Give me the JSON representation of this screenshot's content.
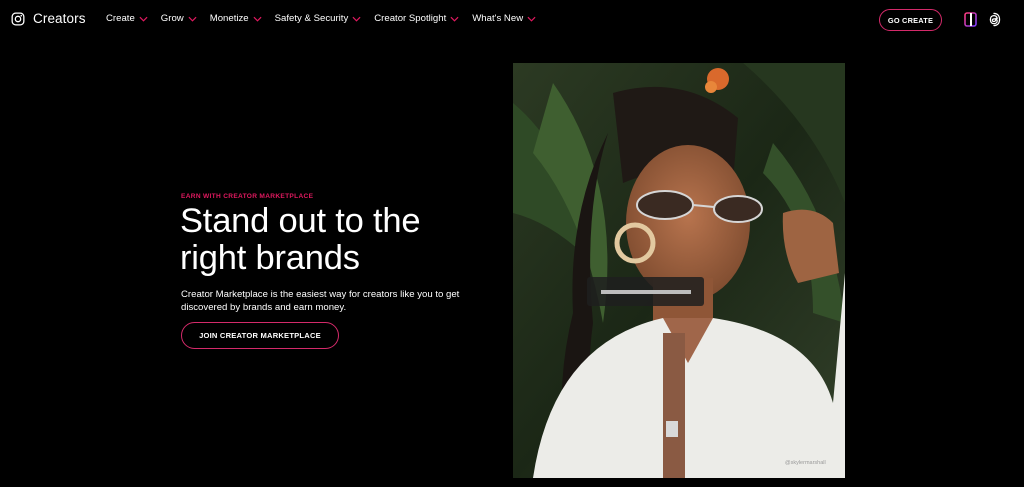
{
  "brand": {
    "name": "Creators",
    "icon": "instagram-icon"
  },
  "nav": {
    "items": [
      {
        "label": "Create"
      },
      {
        "label": "Grow"
      },
      {
        "label": "Monetize"
      },
      {
        "label": "Safety & Security"
      },
      {
        "label": "Creator Spotlight"
      },
      {
        "label": "What's New"
      }
    ],
    "go_create_label": "GO CREATE"
  },
  "hero": {
    "eyebrow": "EARN WITH CREATOR MARKETPLACE",
    "headline": "Stand out to the right brands",
    "body": "Creator Marketplace is the easiest way for creators like you to get discovered by brands and earn money.",
    "cta_label": "JOIN CREATOR MARKETPLACE",
    "image_credit": "@skylermarshall"
  },
  "colors": {
    "accent": "#e0195f",
    "button_border": "#d42a6a",
    "background": "#000000"
  },
  "icons": {
    "nav_chevron": "chevron-down-icon",
    "edits": "edits-app-icon",
    "threads": "threads-icon"
  }
}
